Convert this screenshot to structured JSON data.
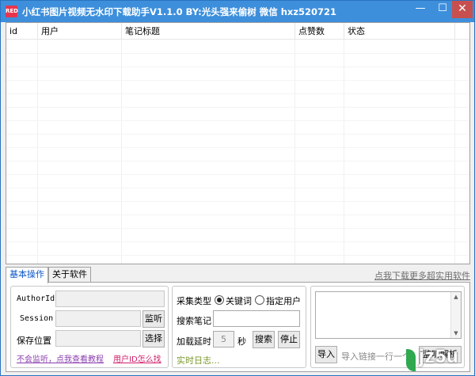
{
  "titlebar": {
    "icon_text": "RED",
    "title": "小红书图片视频无水印下载助手V1.1.0   BY:光头强来偷树   微信 hxz520721",
    "minimize": "—",
    "maximize": "☐",
    "close": "✕"
  },
  "table": {
    "columns": [
      "id",
      "用户",
      "笔记标题",
      "点赞数",
      "状态"
    ],
    "rows": []
  },
  "tabs": [
    {
      "label": "基本操作",
      "active": true
    },
    {
      "label": "关于软件",
      "active": false
    }
  ],
  "top_link": "点我下载更多超实用软件",
  "basic": {
    "authorid_label": "AuthorId",
    "authorid_value": "",
    "session_label": "Session",
    "session_value": "",
    "listen_button": "监听",
    "save_label": "保存位置",
    "save_value": "",
    "choose_button": "选择",
    "tutorial_link": "不会监听，点我查看教程",
    "userid_link": "用户ID怎么找"
  },
  "collect": {
    "type_label": "采集类型",
    "radio_keyword": "关键词",
    "radio_keyword_checked": true,
    "radio_user": "指定用户",
    "radio_user_checked": false,
    "search_label": "搜索笔记",
    "search_value": "",
    "delay_label": "加载延时",
    "delay_value": "5",
    "delay_unit": "秒",
    "search_button": "搜索",
    "stop_button": "停止",
    "log_label": "实时日志..."
  },
  "import": {
    "textarea_value": "",
    "import_button": "导入",
    "hint": "导入链接一行一个",
    "trailing_button": "监听解析"
  },
  "watermark": {
    "text": "jz5u"
  },
  "colors": {
    "titlebar": "#3d8fdc",
    "close_button": "#c7504f",
    "active_tab_text": "#0a55c8",
    "link_purple": "#8b3fb0",
    "link_pink": "#d0206a",
    "log_text": "#7a9a2a"
  }
}
